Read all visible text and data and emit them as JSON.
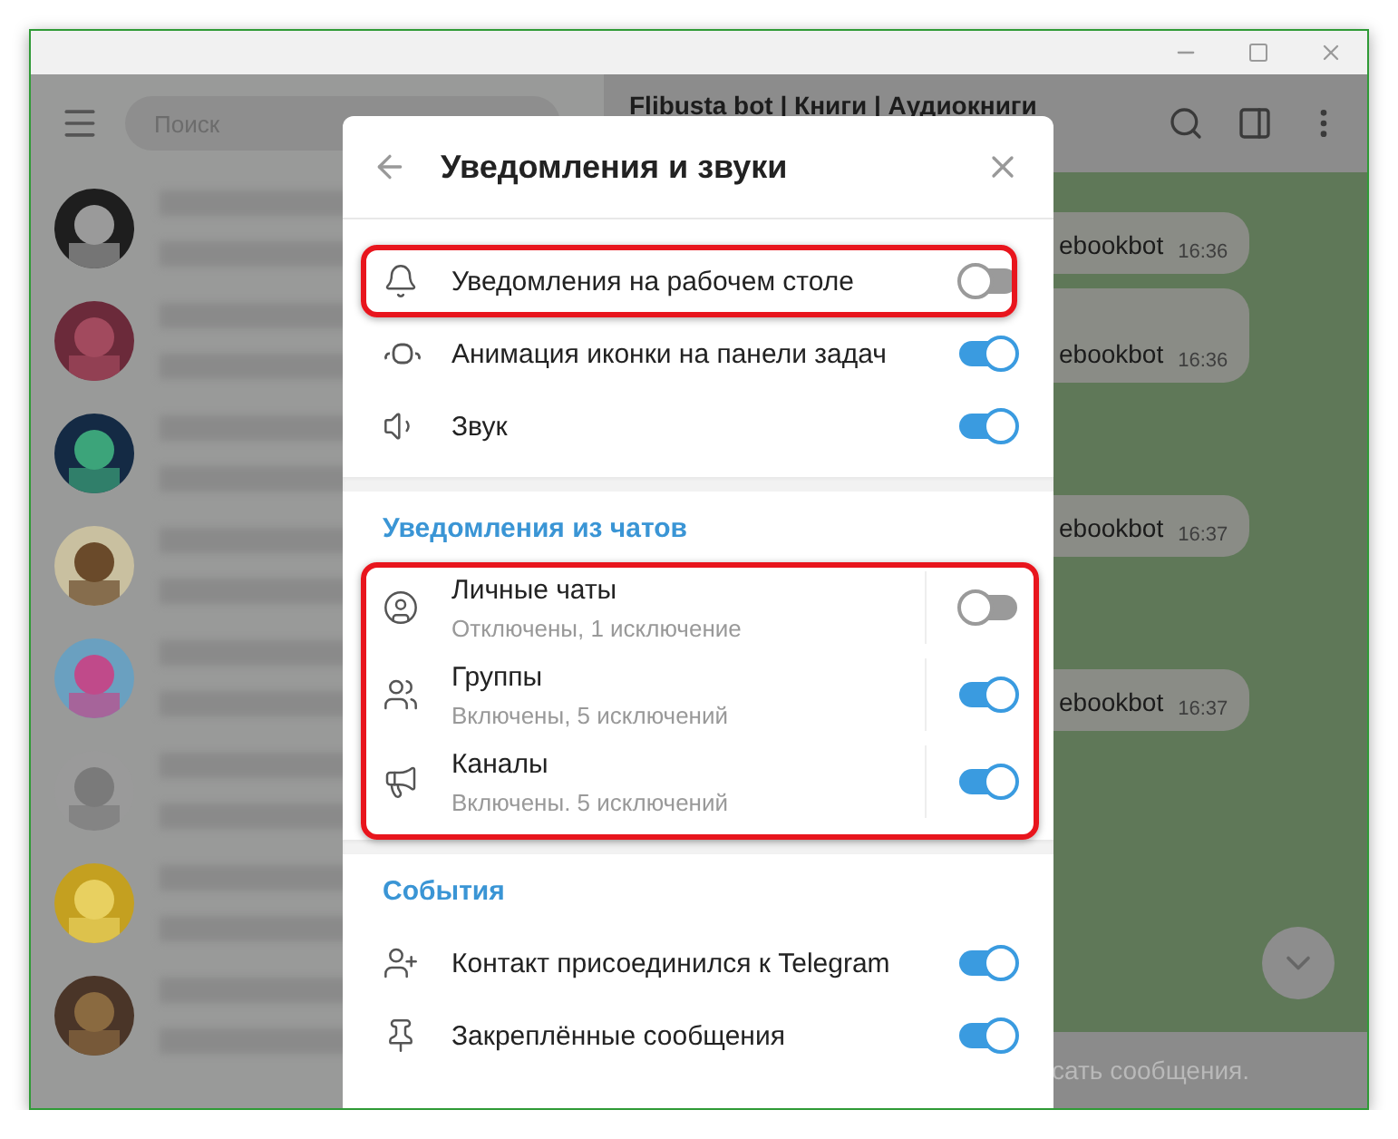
{
  "sidebar": {
    "search": {
      "placeholder": "Поиск"
    }
  },
  "chat": {
    "title": "Flibusta bot | Книги | Аудиокниги",
    "messages": [
      {
        "text": "ebookbot",
        "time": "16:36"
      },
      {
        "text": "ebookbot",
        "time": "16:36"
      },
      {
        "text": "ebookbot",
        "time": "16:37"
      },
      {
        "text": "ebookbot",
        "time": "16:37"
      }
    ],
    "composer": {
      "placeholder": "сать сообщения."
    }
  },
  "modal": {
    "title": "Уведомления и звуки",
    "sections": [
      {
        "rows": [
          {
            "label": "Уведомления на рабочем столе",
            "on": false,
            "highlighted": true
          },
          {
            "label": "Анимация иконки на панели задач",
            "on": true,
            "highlighted": false
          },
          {
            "label": "Звук",
            "on": true,
            "highlighted": false
          }
        ]
      },
      {
        "title": "Уведомления из чатов",
        "highlighted": true,
        "rows": [
          {
            "label": "Личные чаты",
            "sublabel": "Отключены, 1 исключение",
            "on": false
          },
          {
            "label": "Группы",
            "sublabel": "Включены, 5 исключений",
            "on": true
          },
          {
            "label": "Каналы",
            "sublabel": "Включены. 5 исключений",
            "on": true
          }
        ]
      },
      {
        "title": "События",
        "rows": [
          {
            "label": "Контакт присоединился к Telegram",
            "on": true,
            "highlighted": false
          },
          {
            "label": "Закреплённые сообщения",
            "on": true,
            "highlighted": false
          }
        ]
      }
    ]
  }
}
